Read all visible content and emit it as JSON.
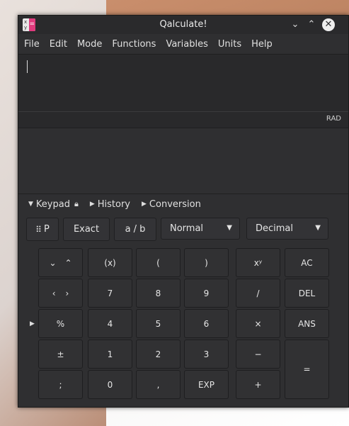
{
  "window": {
    "title": "Qalculate!"
  },
  "menu": [
    "File",
    "Edit",
    "Mode",
    "Functions",
    "Variables",
    "Units",
    "Help"
  ],
  "status": {
    "angle_mode": "RAD"
  },
  "tabs": {
    "keypad": "Keypad",
    "history": "History",
    "conversion": "Conversion"
  },
  "toolbar": {
    "p_label": "P",
    "exact": "Exact",
    "fraction": "a / b",
    "normal": "Normal",
    "decimal": "Decimal"
  },
  "keys": {
    "r1": [
      "(x)",
      "(",
      ")",
      "xʸ",
      "AC"
    ],
    "r2": [
      "7",
      "8",
      "9",
      "/",
      "DEL"
    ],
    "r3": [
      "%",
      "4",
      "5",
      "6",
      "×",
      "ANS"
    ],
    "r4": [
      "±",
      "1",
      "2",
      "3",
      "−"
    ],
    "r5": [
      ";",
      "0",
      ",",
      "EXP",
      "+"
    ],
    "equals": "="
  },
  "icons": {
    "app": "qalculate-icon",
    "minimize": "chevron-down-icon",
    "maximize": "chevron-up-icon",
    "close": "close-icon"
  }
}
